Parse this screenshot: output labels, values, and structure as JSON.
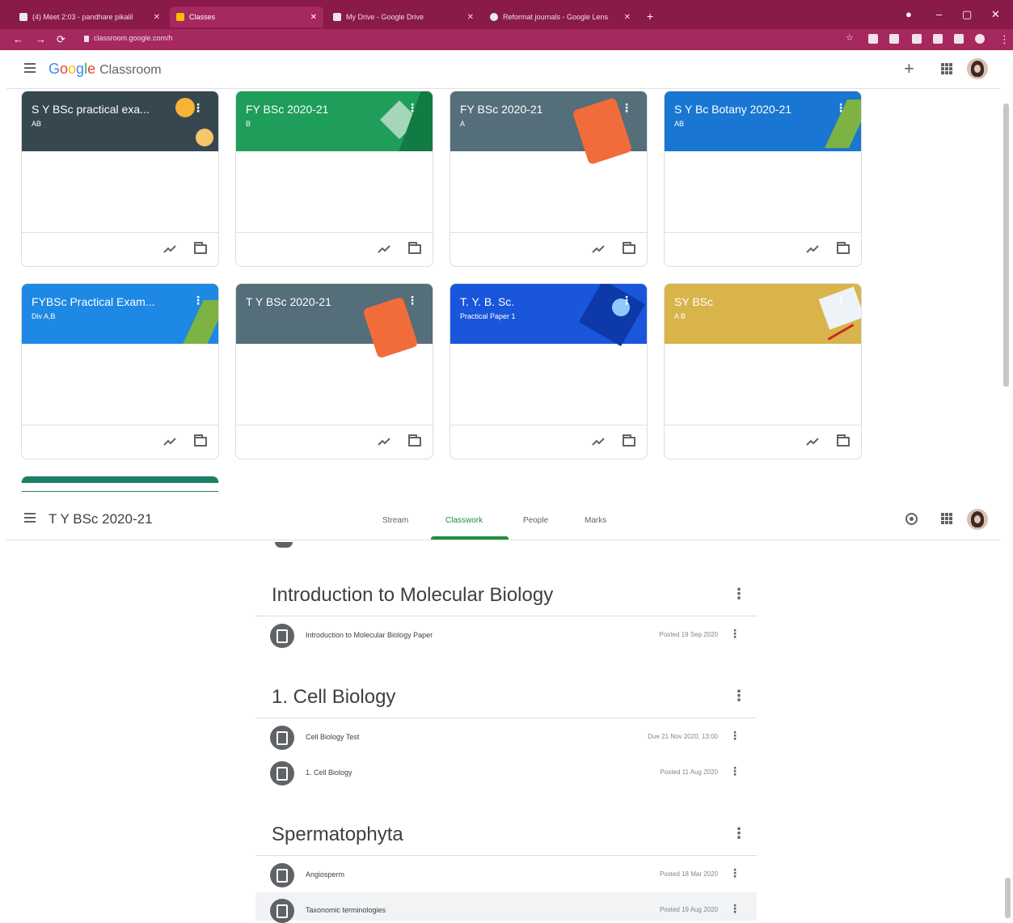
{
  "browser": {
    "tabs": [
      {
        "label": "(4) Meet 2:03 - pandhare pikalil",
        "fav": "#e8eaed"
      },
      {
        "label": "Classes",
        "fav": "#fbbc04"
      },
      {
        "label": "My Drive - Google Drive",
        "fav": "#e8eaed"
      },
      {
        "label": "Reformat journals - Google Lens",
        "fav": "#e8eaed"
      }
    ],
    "url": "classroom.google.com/h"
  },
  "home": {
    "app_name": "Classroom",
    "add_icon": "+",
    "cards": [
      {
        "title": "S Y BSc practical exa...",
        "sub": "AB",
        "color": "#37474f"
      },
      {
        "title": "FY BSc 2020-21",
        "sub": "B",
        "color": "#1e9e5a"
      },
      {
        "title": "FY BSc 2020-21",
        "sub": "A",
        "color": "#546e7a"
      },
      {
        "title": "S Y Bc Botany 2020-21",
        "sub": "AB",
        "color": "#1976d2"
      },
      {
        "title": "FYBSc Practical Exam...",
        "sub": "Div A,B",
        "color": "#1e88e5"
      },
      {
        "title": "T Y BSc 2020-21",
        "sub": "",
        "color": "#546e7a"
      },
      {
        "title": "T. Y. B. Sc.",
        "sub": "Practical Paper 1",
        "color": "#1a56db"
      },
      {
        "title": "SY BSc",
        "sub": "A B",
        "color": "#d9b44a"
      }
    ]
  },
  "classpage": {
    "title": "T Y BSc 2020-21",
    "tabs": [
      "Stream",
      "Classwork",
      "People",
      "Marks"
    ],
    "topics": [
      {
        "title": "Introduction to Molecular Biology",
        "items": [
          {
            "name": "Introduction to Molecular Biology Paper",
            "date": "Posted 19 Sep 2020"
          }
        ]
      },
      {
        "title": "1. Cell Biology",
        "items": [
          {
            "name": "Cell Biology Test",
            "date": "Due 21 Nov 2020, 13:00"
          },
          {
            "name": "1. Cell Biology",
            "date": "Posted 11 Aug 2020"
          }
        ]
      },
      {
        "title": "Spermatophyta",
        "items": [
          {
            "name": "Angiosperm",
            "date": "Posted 18 Mar 2020"
          },
          {
            "name": "Taxonomic terminologies",
            "date": "Posted 19 Aug 2020"
          }
        ]
      }
    ]
  }
}
